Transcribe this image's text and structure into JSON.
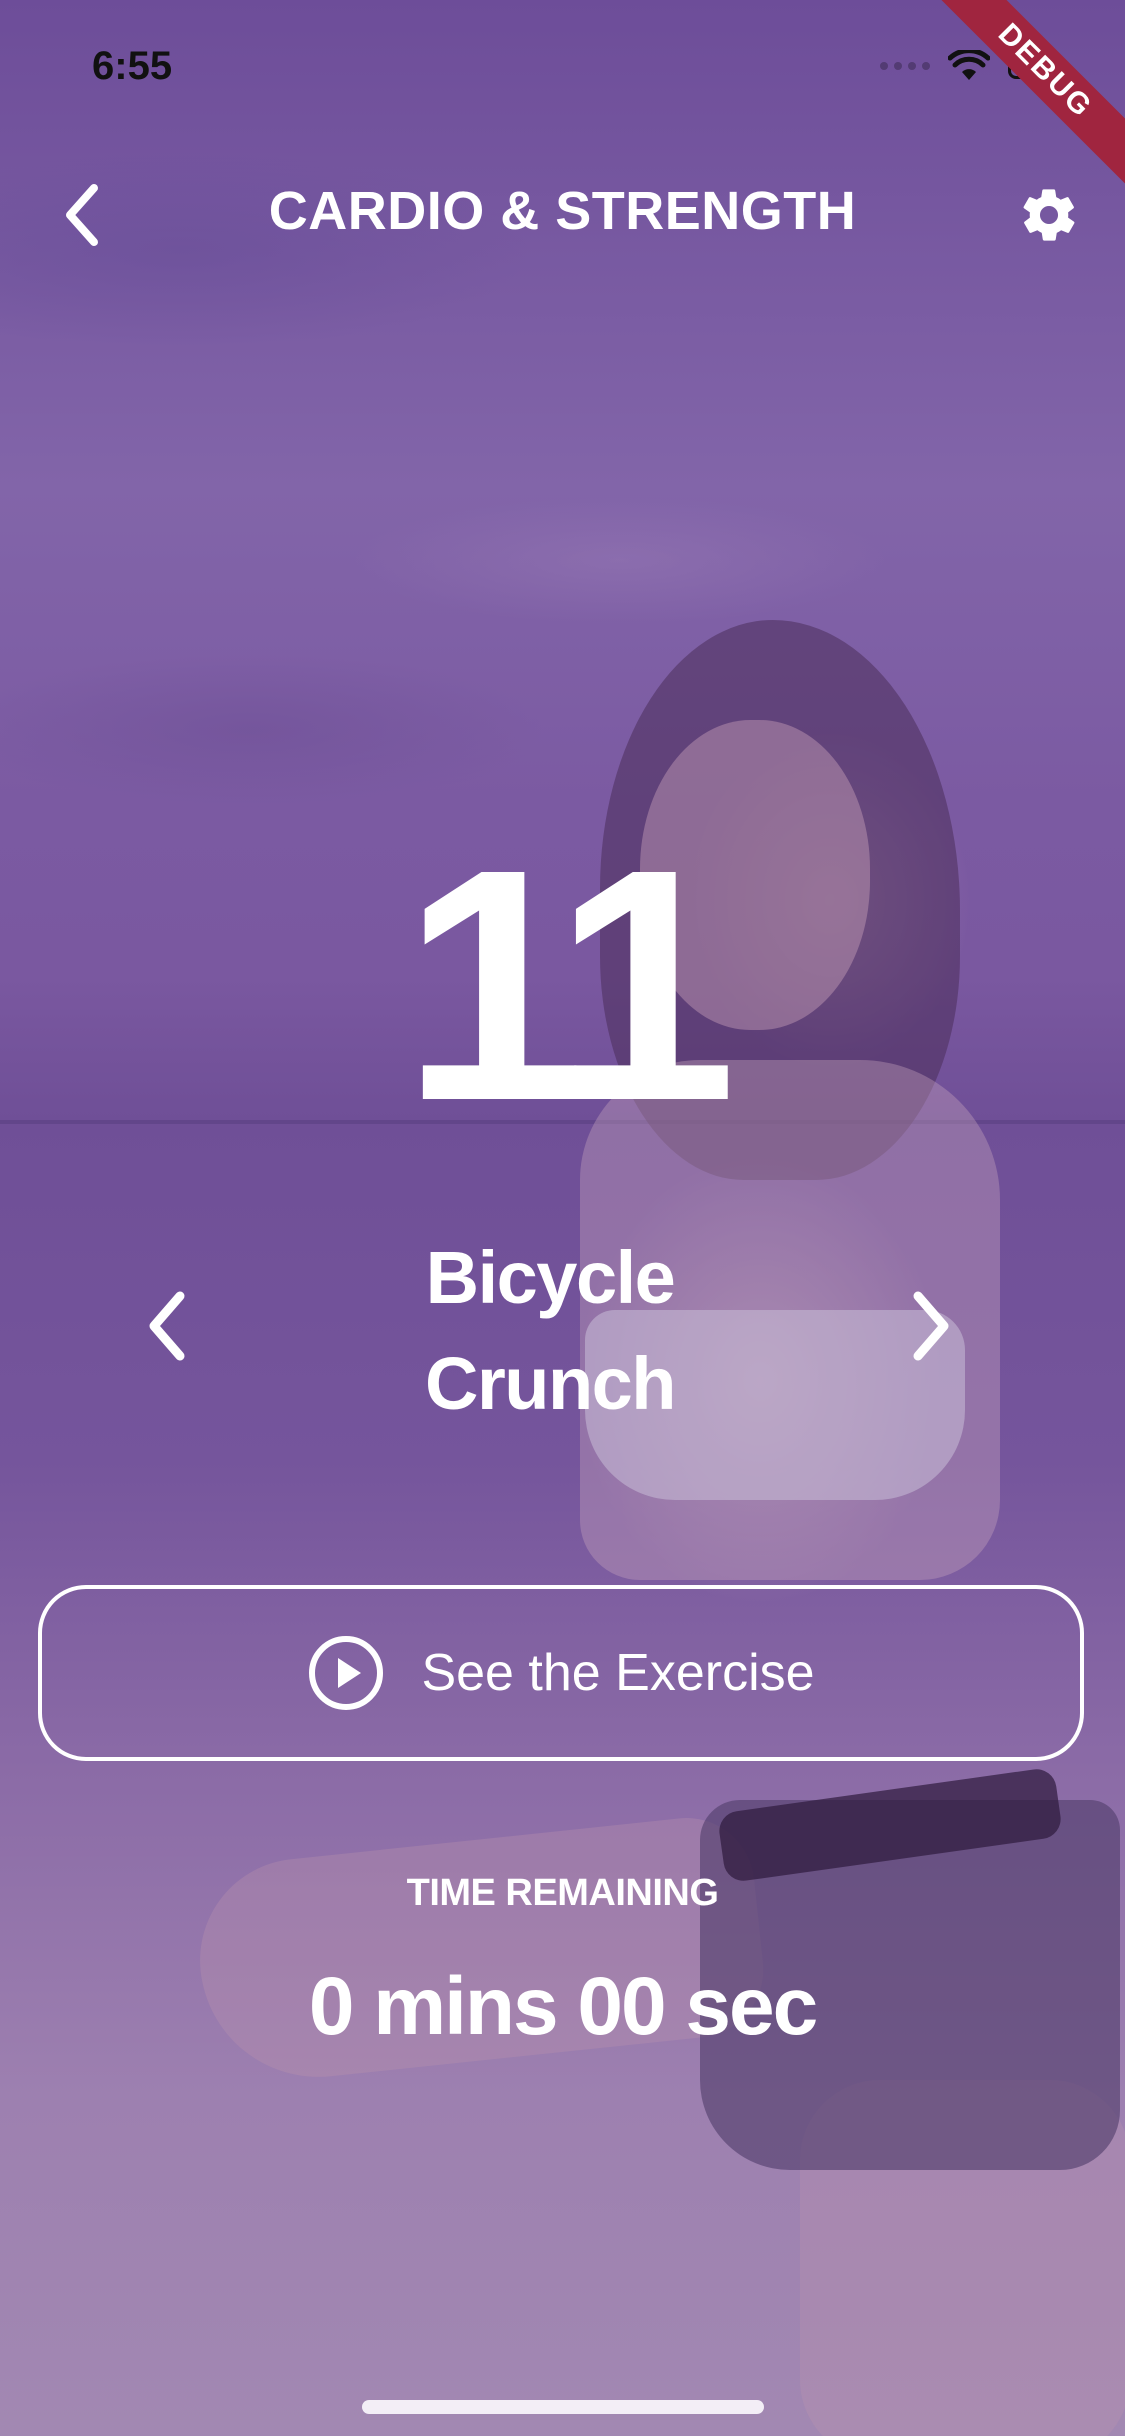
{
  "status_bar": {
    "time": "6:55",
    "icons": [
      "signal-dots-icon",
      "wifi-icon",
      "battery-icon"
    ]
  },
  "debug_banner": "DEBUG",
  "header": {
    "title": "CARDIO & STRENGTH",
    "back_icon": "chevron-left-icon",
    "settings_icon": "gear-icon"
  },
  "exercise": {
    "counter": "11",
    "name_line1": "Bicycle",
    "name_line2": "Crunch",
    "prev_icon": "chevron-left-icon",
    "next_icon": "chevron-right-icon"
  },
  "see_exercise_button": {
    "label": "See the Exercise",
    "icon": "play-circle-icon"
  },
  "timer": {
    "label": "TIME REMAINING",
    "value": "0 mins 00 sec"
  },
  "colors": {
    "overlay": "#7a5a9c",
    "text": "#ffffff",
    "debug_ribbon": "#a0253f"
  }
}
